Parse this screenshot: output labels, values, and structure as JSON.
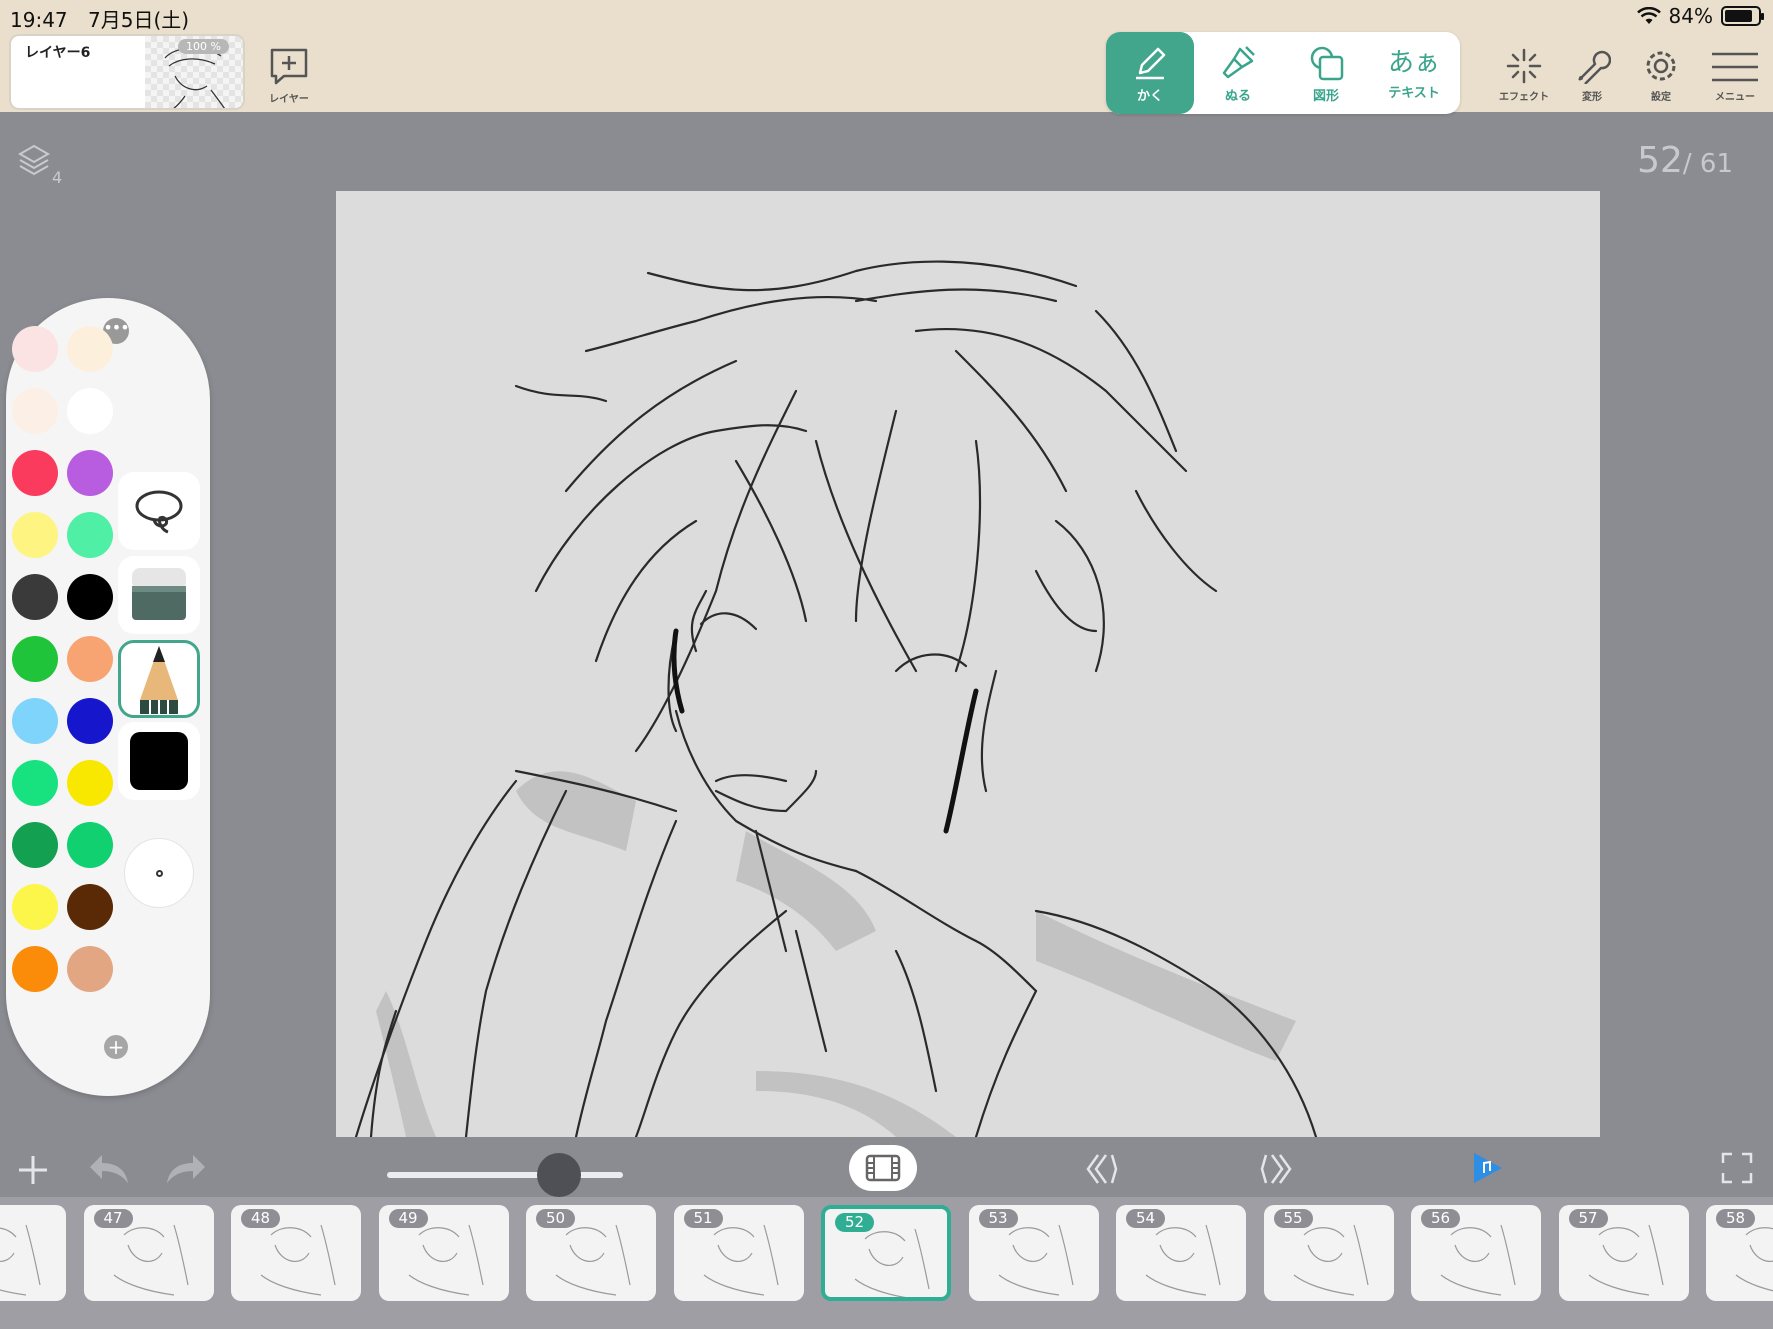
{
  "status_bar": {
    "time": "19:47",
    "date": "7月5日(土)",
    "battery": "84%",
    "battery_level": 0.84
  },
  "layer": {
    "name": "レイヤー6",
    "opacity": "100 %"
  },
  "toolbar": {
    "add_layer_label": "レイヤー",
    "tools": [
      {
        "id": "draw",
        "label": "かく",
        "icon": "pen-icon",
        "active": true
      },
      {
        "id": "fill",
        "label": "ぬる",
        "icon": "brush-icon",
        "active": false
      },
      {
        "id": "shape",
        "label": "図形",
        "icon": "shape-icon",
        "active": false
      },
      {
        "id": "text",
        "label": "テキスト",
        "icon": "text-icon",
        "glyph": "あぁ",
        "active": false
      }
    ],
    "effect_label": "エフェクト",
    "transform_label": "変形",
    "settings_label": "設定",
    "menu_label": "メニュー"
  },
  "canvas": {
    "layer_count": "4",
    "frame_current": "52",
    "frame_total": "/ 61"
  },
  "palette": {
    "colors": [
      [
        "#fbe3e3",
        "#fcf0dd"
      ],
      [
        "#fcefe6",
        "#ffffff"
      ],
      [
        "#fb3b5e",
        "#b85ce0"
      ],
      [
        "#fdf482",
        "#4ff0a5"
      ],
      [
        "#3a3a3a",
        "#000000"
      ],
      [
        "#20c43a",
        "#f7a472"
      ],
      [
        "#7ed4fb",
        "#1616cc"
      ],
      [
        "#18e280",
        "#f8e800"
      ],
      [
        "#13a050",
        "#10d070"
      ],
      [
        "#fcf54a",
        "#5a2a06"
      ],
      [
        "#fb8c0a",
        "#e3a683"
      ]
    ],
    "tools": [
      "lasso-icon",
      "eraser-icon",
      "pencil-icon",
      "color-black-swatch",
      "brush-size-dot"
    ],
    "current_color": "#000000"
  },
  "bottom_bar": {
    "brush_size_slider": 0.73,
    "play_color": "#2d8ee6"
  },
  "frames": [
    {
      "num": ""
    },
    {
      "num": "47"
    },
    {
      "num": "48"
    },
    {
      "num": "49"
    },
    {
      "num": "50"
    },
    {
      "num": "51"
    },
    {
      "num": "52",
      "current": true
    },
    {
      "num": "53"
    },
    {
      "num": "54"
    },
    {
      "num": "55"
    },
    {
      "num": "56"
    },
    {
      "num": "57"
    },
    {
      "num": "58"
    }
  ]
}
